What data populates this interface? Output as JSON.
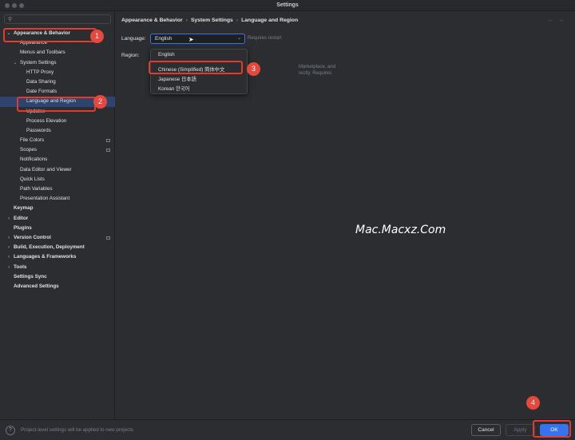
{
  "window": {
    "title": "Settings"
  },
  "sidebar": {
    "search_icon": "search-icon",
    "items": [
      {
        "label": "Appearance & Behavior",
        "indent": 0,
        "bold": true,
        "chevron": "v",
        "name": "sidebar-item-appearance-behavior"
      },
      {
        "label": "Appearance",
        "indent": 1,
        "name": "sidebar-item-appearance"
      },
      {
        "label": "Menus and Toolbars",
        "indent": 1,
        "name": "sidebar-item-menus-toolbars"
      },
      {
        "label": "System Settings",
        "indent": 1,
        "chevron": "v",
        "name": "sidebar-item-system-settings"
      },
      {
        "label": "HTTP Proxy",
        "indent": 2,
        "name": "sidebar-item-http-proxy"
      },
      {
        "label": "Data Sharing",
        "indent": 2,
        "name": "sidebar-item-data-sharing"
      },
      {
        "label": "Date Formats",
        "indent": 2,
        "name": "sidebar-item-date-formats"
      },
      {
        "label": "Language and Region",
        "indent": 2,
        "selected": true,
        "name": "sidebar-item-language-region"
      },
      {
        "label": "Updates",
        "indent": 2,
        "name": "sidebar-item-updates"
      },
      {
        "label": "Process Elevation",
        "indent": 2,
        "name": "sidebar-item-process-elevation"
      },
      {
        "label": "Passwords",
        "indent": 2,
        "name": "sidebar-item-passwords"
      },
      {
        "label": "File Colors",
        "indent": 1,
        "pin": true,
        "name": "sidebar-item-file-colors"
      },
      {
        "label": "Scopes",
        "indent": 1,
        "pin": true,
        "name": "sidebar-item-scopes"
      },
      {
        "label": "Notifications",
        "indent": 1,
        "name": "sidebar-item-notifications"
      },
      {
        "label": "Data Editor and Viewer",
        "indent": 1,
        "name": "sidebar-item-data-editor"
      },
      {
        "label": "Quick Lists",
        "indent": 1,
        "name": "sidebar-item-quick-lists"
      },
      {
        "label": "Path Variables",
        "indent": 1,
        "name": "sidebar-item-path-variables"
      },
      {
        "label": "Presentation Assistant",
        "indent": 1,
        "name": "sidebar-item-presentation-assistant"
      },
      {
        "label": "Keymap",
        "indent": 0,
        "bold": true,
        "name": "sidebar-item-keymap"
      },
      {
        "label": "Editor",
        "indent": 0,
        "bold": true,
        "chevron": ">",
        "name": "sidebar-item-editor"
      },
      {
        "label": "Plugins",
        "indent": 0,
        "bold": true,
        "name": "sidebar-item-plugins"
      },
      {
        "label": "Version Control",
        "indent": 0,
        "bold": true,
        "chevron": ">",
        "pin": true,
        "name": "sidebar-item-version-control"
      },
      {
        "label": "Build, Execution, Deployment",
        "indent": 0,
        "bold": true,
        "chevron": ">",
        "name": "sidebar-item-build"
      },
      {
        "label": "Languages & Frameworks",
        "indent": 0,
        "bold": true,
        "chevron": ">",
        "name": "sidebar-item-languages-frameworks"
      },
      {
        "label": "Tools",
        "indent": 0,
        "bold": true,
        "chevron": ">",
        "name": "sidebar-item-tools"
      },
      {
        "label": "Settings Sync",
        "indent": 0,
        "bold": true,
        "name": "sidebar-item-settings-sync"
      },
      {
        "label": "Advanced Settings",
        "indent": 0,
        "bold": true,
        "name": "sidebar-item-advanced-settings"
      }
    ]
  },
  "breadcrumb": [
    "Appearance & Behavior",
    "System Settings",
    "Language and Region"
  ],
  "nav": {
    "back": "←",
    "forward": "→"
  },
  "form": {
    "language_label": "Language:",
    "language_value": "English",
    "restart_note": "Requires restart",
    "region_label": "Region:",
    "region_hint_1": "Marketplace, and",
    "region_hint_2": "rectly. Requires"
  },
  "dropdown": {
    "options": [
      "English",
      "Chinese (Simplified) 简体中文",
      "Japanese 日本語",
      "Korean 한국어"
    ],
    "highlighted": "Chinese (Simplified) 简体中文"
  },
  "watermark": "Mac.Macxz.Com",
  "footer": {
    "help": "?",
    "note": "Project-level settings will be applied to new projects",
    "cancel": "Cancel",
    "apply": "Apply",
    "ok": "OK"
  },
  "annotations": {
    "step1": "1",
    "step2": "2",
    "step3": "3",
    "step4": "4",
    "color": "#e23b2e"
  },
  "colors": {
    "accent": "#3574f0",
    "selection": "#2e436e",
    "background": "#2b2d30"
  }
}
